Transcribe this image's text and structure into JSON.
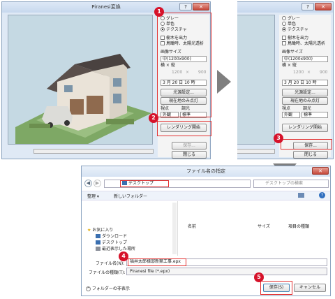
{
  "dialog1": {
    "title": "Piranesi変換",
    "help_label": "?",
    "close_label": "✕",
    "radio_gray": "グレー",
    "radio_mono": "単色",
    "radio_texture": "テクスチャ",
    "check_tree": "樹木を出力",
    "check_bird": "鳥瞰時、太陽光透析",
    "image_size_label": "画像サイズ",
    "image_size_value": "中(1200x900)",
    "wh_label": "横 × 縦",
    "width_value": "1200",
    "times_label": "×",
    "height_value": "900",
    "date_value": "3 月 20 日 10 時",
    "light_settings_button": "光源設定...",
    "current_light_button": "現在地のみ点灯",
    "viewpoint_label": "視点",
    "tone_label": "調光",
    "viewpoint_value": "外観",
    "tone_value": "標準",
    "render_button": "レンダリング開始",
    "save_button": "保存...",
    "close_button": "閉じる"
  },
  "dialog2": {
    "help_label": "?",
    "close_label": "✕",
    "radio_gray": "グレー",
    "radio_mono": "単色",
    "radio_texture": "テクスチャ",
    "check_tree": "樹木を出力",
    "check_bird": "鳥瞰時、太陽光透析",
    "image_size_label": "画像サイズ",
    "image_size_value": "中(1200x900)",
    "wh_label": "横 × 縦",
    "width_value": "1200",
    "times_label": "×",
    "height_value": "900",
    "date_value": "3 月 20 日 10 時",
    "light_settings_button": "光源設定...",
    "current_light_button": "現在地のみ点灯",
    "viewpoint_label": "視点",
    "tone_label": "調光",
    "viewpoint_value": "外観",
    "tone_value": "標準",
    "render_button": "レンダリング開始",
    "save_button": "保存...",
    "close_button": "閉じる"
  },
  "file_dialog": {
    "title": "ファイル名の指定",
    "close_label": "✕",
    "location": "デスクトップ",
    "search_placeholder": "デスクトップの検索",
    "organize": "整理 ▾",
    "new_folder": "新しいフォルダー",
    "fav_group": "お気に入り",
    "fav_items": [
      "ダウンロード",
      "デスクトップ",
      "最近表示した場所"
    ],
    "col_name": "名前",
    "col_size": "サイズ",
    "col_type": "項目の種類",
    "filename_label": "ファイル名(N):",
    "filename_value": "福井太郎様邸新築工事.epx",
    "filetype_label": "ファイルの種類(T):",
    "filetype_value": "Piranesi file (*.epx)",
    "hide_folders": "フォルダーの非表示",
    "save_button": "保存(S)",
    "cancel_button": "キャンセル"
  },
  "badges": [
    "1",
    "2",
    "3",
    "4",
    "5"
  ]
}
